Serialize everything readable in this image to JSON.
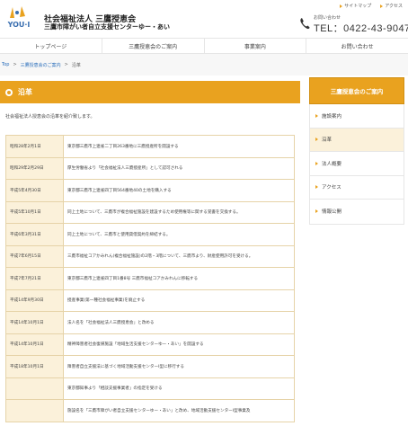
{
  "header": {
    "org_title": "社会福祉法人 三鷹授恵会",
    "org_subtitle": "三鷹市障がい者自立支援センターゆー・あい",
    "top_links": [
      "サイトマップ",
      "アクセス"
    ],
    "contact_label": "お問い合わせ",
    "tel": "TEL：0422-43-9047"
  },
  "nav": [
    "トップページ",
    "三鷹授恵会のご案内",
    "事業案内",
    "お問い合わせ"
  ],
  "breadcrumb": [
    "Top",
    "三鷹授恵会のご案内",
    "沿革"
  ],
  "page_title": "沿革",
  "intro": "社会福祉法人授恵会の沿革を紹介致します。",
  "history": [
    {
      "date": "昭和28年2月1日",
      "event": "東京都三鷹市上連雀二丁目263番地に三鷹授産所を開設する"
    },
    {
      "date": "昭和29年2月29日",
      "event": "厚生労働省より「社会福祉法人三鷹授産所」として認可される"
    },
    {
      "date": "平成5年4月30日",
      "event": "東京都三鷹市上連雀四丁目564番地40の土地を購入する"
    },
    {
      "date": "平成5年10月1日",
      "event": "同上土地について、三鷹市が複合福祉施設を建設するため使用権等に関する覚書を交換する。"
    },
    {
      "date": "平成6年3月31日",
      "event": "同上土地について、三鷹市と使用貸借契約を締結する。"
    },
    {
      "date": "平成7年6月15日",
      "event": "三鷹市福祉コアかみれん(複合福祉施設)の2階・3階について、三鷹市より、財産使用許可を受ける。"
    },
    {
      "date": "平成7年7月21日",
      "event": "東京都三鷹市上連雀四丁目1番8号 三鷹市福祉コアかみれんに移転する"
    },
    {
      "date": "平成14年9月30日",
      "event": "授産事業(第一種社会福祉事業)を廃止する"
    },
    {
      "date": "平成14年10月1日",
      "event": "法人名を「社会福祉法人三鷹授恵会」と改める"
    },
    {
      "date": "平成14年10月1日",
      "event": "精神障害者社会復帰施設「地域生活支援センターゆー・あい」を開設する"
    },
    {
      "date": "平成18年10月1日",
      "event": "障害者自立支援法に基づく地域活動支援センターⅠ型に移行する"
    },
    {
      "date": "",
      "event": "東京都知事より「相談支援事業者」の指定を受ける"
    },
    {
      "date": "",
      "event": "施設名を「三鷹市障がい者自立支援センターゆー・あい」と改め、地域活動支援センターⅠ型事業及"
    }
  ],
  "sidebar": {
    "title": "三鷹授恵会のご案内",
    "items": [
      "施設案内",
      "沿革",
      "法人概要",
      "アクセス",
      "情報公開"
    ],
    "active_index": 1
  },
  "colors": {
    "accent": "#e9a21f",
    "row_bg": "#fbf1da",
    "link": "#2a6ebb"
  }
}
